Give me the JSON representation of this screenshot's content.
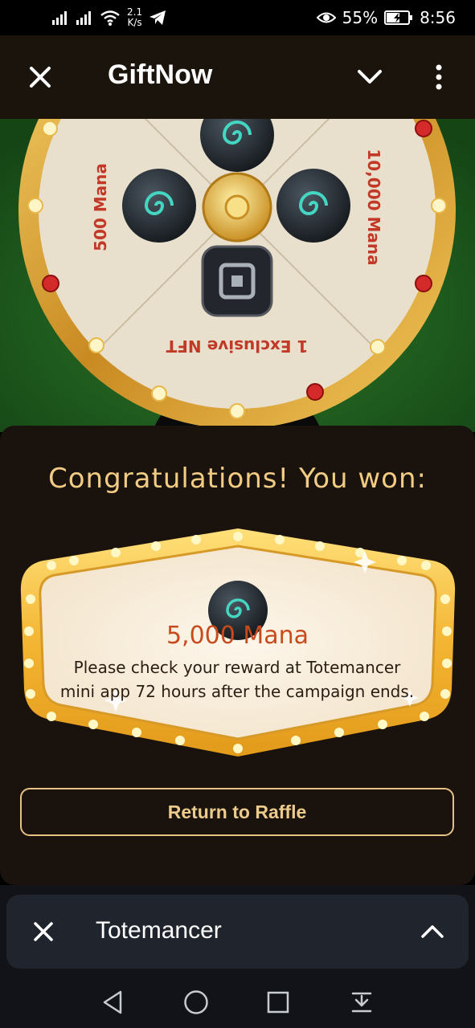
{
  "status_bar": {
    "speed_value": "2.1",
    "speed_unit": "K/s",
    "battery": "55%",
    "time": "8:56"
  },
  "appbar": {
    "title": "GiftNow"
  },
  "wheel": {
    "segment_left": "500 Mana",
    "segment_right": "10,000 Mana",
    "segment_bottom": "1 Exclusive NFT"
  },
  "result": {
    "heading": "Congratulations! You won:",
    "prize": "5,000 Mana",
    "description": "Please check your reward at Totemancer mini app 72 hours after the campaign ends."
  },
  "actions": {
    "return_label": "Return to Raffle"
  },
  "mini_app_bar": {
    "title": "Totemancer"
  },
  "colors": {
    "accent_gold": "#f3cc84",
    "prize_red": "#c84b1d",
    "panel_bg": "#1a120c"
  }
}
